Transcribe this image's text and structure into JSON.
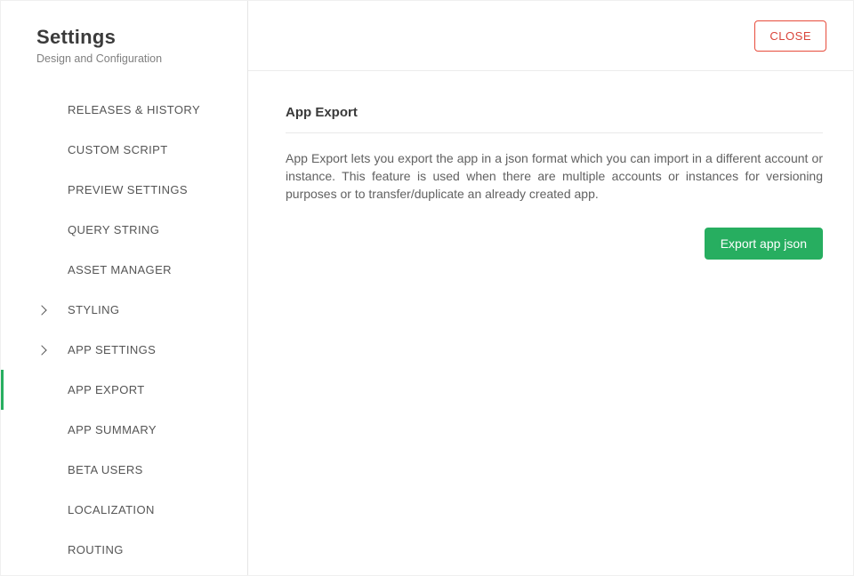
{
  "sidebar": {
    "title": "Settings",
    "subtitle": "Design and Configuration",
    "items": [
      {
        "label": "RELEASES & HISTORY",
        "expandable": false,
        "active": false
      },
      {
        "label": "CUSTOM SCRIPT",
        "expandable": false,
        "active": false
      },
      {
        "label": "PREVIEW SETTINGS",
        "expandable": false,
        "active": false
      },
      {
        "label": "QUERY STRING",
        "expandable": false,
        "active": false
      },
      {
        "label": "ASSET MANAGER",
        "expandable": false,
        "active": false
      },
      {
        "label": "STYLING",
        "expandable": true,
        "active": false
      },
      {
        "label": "APP SETTINGS",
        "expandable": true,
        "active": false
      },
      {
        "label": "APP EXPORT",
        "expandable": false,
        "active": true
      },
      {
        "label": "APP SUMMARY",
        "expandable": false,
        "active": false
      },
      {
        "label": "BETA USERS",
        "expandable": false,
        "active": false
      },
      {
        "label": "LOCALIZATION",
        "expandable": false,
        "active": false
      },
      {
        "label": "ROUTING",
        "expandable": false,
        "active": false
      }
    ]
  },
  "topbar": {
    "close_label": "CLOSE"
  },
  "main": {
    "section_title": "App Export",
    "section_desc": "App Export lets you export the app in a json format which you can import in a different account or instance. This feature is used when there are multiple accounts or instances for versioning purposes or to transfer/duplicate an already created app.",
    "primary_button": "Export app json"
  }
}
